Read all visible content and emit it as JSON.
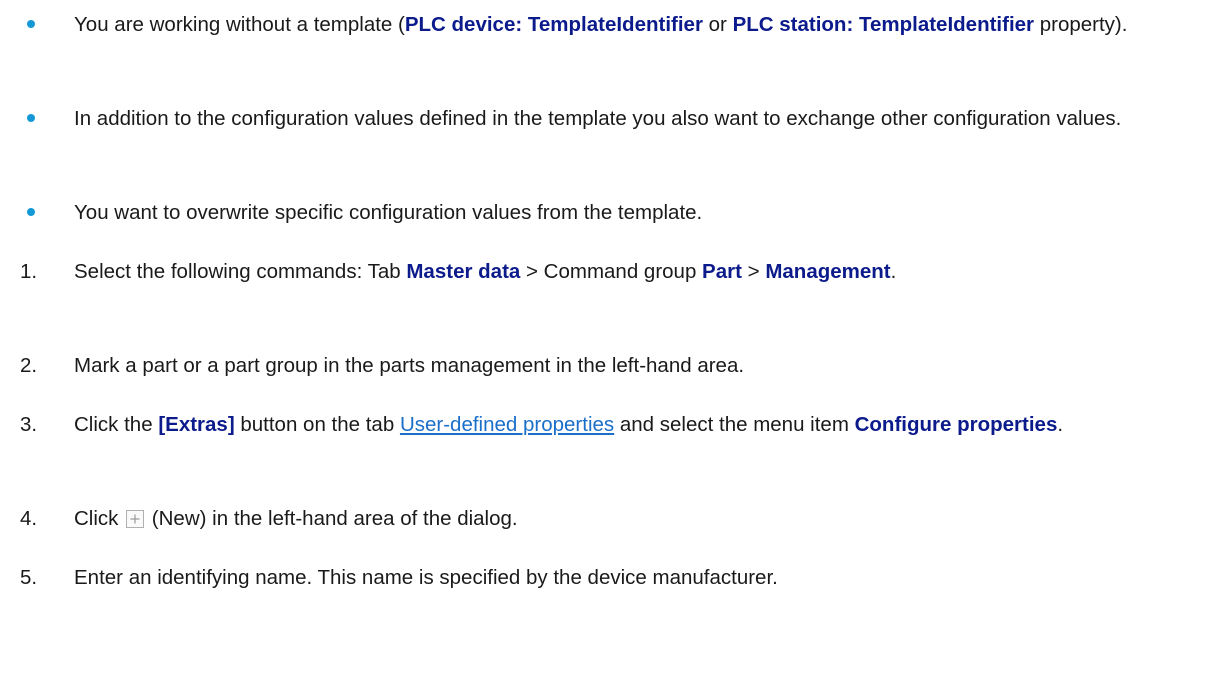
{
  "bullets": [
    {
      "parts": [
        {
          "t": "You are working without a template (",
          "s": "n"
        },
        {
          "t": "PLC device: TemplateIdentifier",
          "s": "b"
        },
        {
          "t": " or ",
          "s": "n"
        },
        {
          "t": "PLC station: TemplateIdentifier",
          "s": "b"
        },
        {
          "t": " property).",
          "s": "n"
        }
      ]
    },
    {
      "parts": [
        {
          "t": "In addition to the configuration values defined in the template you also want to exchange other configuration values.",
          "s": "n"
        }
      ]
    },
    {
      "parts": [
        {
          "t": "You want to overwrite specific configuration values from the template.",
          "s": "n"
        }
      ]
    }
  ],
  "steps": [
    {
      "number": "1.",
      "parts": [
        {
          "t": "Select the following commands: Tab ",
          "s": "n"
        },
        {
          "t": "Master data",
          "s": "b"
        },
        {
          "t": " > Command group ",
          "s": "n"
        },
        {
          "t": "Part",
          "s": "b"
        },
        {
          "t": " > ",
          "s": "n"
        },
        {
          "t": "Management",
          "s": "b"
        },
        {
          "t": ".",
          "s": "n"
        }
      ]
    },
    {
      "number": "2.",
      "parts": [
        {
          "t": "Mark a part or a part group in the parts management in the left-hand area.",
          "s": "n"
        }
      ]
    },
    {
      "number": "3.",
      "parts": [
        {
          "t": "Click the ",
          "s": "n"
        },
        {
          "t": "[Extras]",
          "s": "b"
        },
        {
          "t": " button on the tab ",
          "s": "n"
        },
        {
          "t": "User-defined properties",
          "s": "link"
        },
        {
          "t": " and select the menu item ",
          "s": "n"
        },
        {
          "t": "Configure properties",
          "s": "b"
        },
        {
          "t": ".",
          "s": "n"
        }
      ]
    },
    {
      "number": "4.",
      "parts": [
        {
          "t": "Click ",
          "s": "n"
        },
        {
          "t": "",
          "s": "icon",
          "icon": "plus-new-icon"
        },
        {
          "t": " (New) in the left-hand area of the dialog.",
          "s": "n"
        }
      ]
    },
    {
      "number": "5.",
      "parts": [
        {
          "t": "Enter an identifying name. This name is specified by the device manufacturer.",
          "s": "n"
        }
      ]
    }
  ],
  "colors": {
    "bullet": "#1599d6",
    "bold_text": "#0c1b8c",
    "link": "#1a6fc9"
  }
}
